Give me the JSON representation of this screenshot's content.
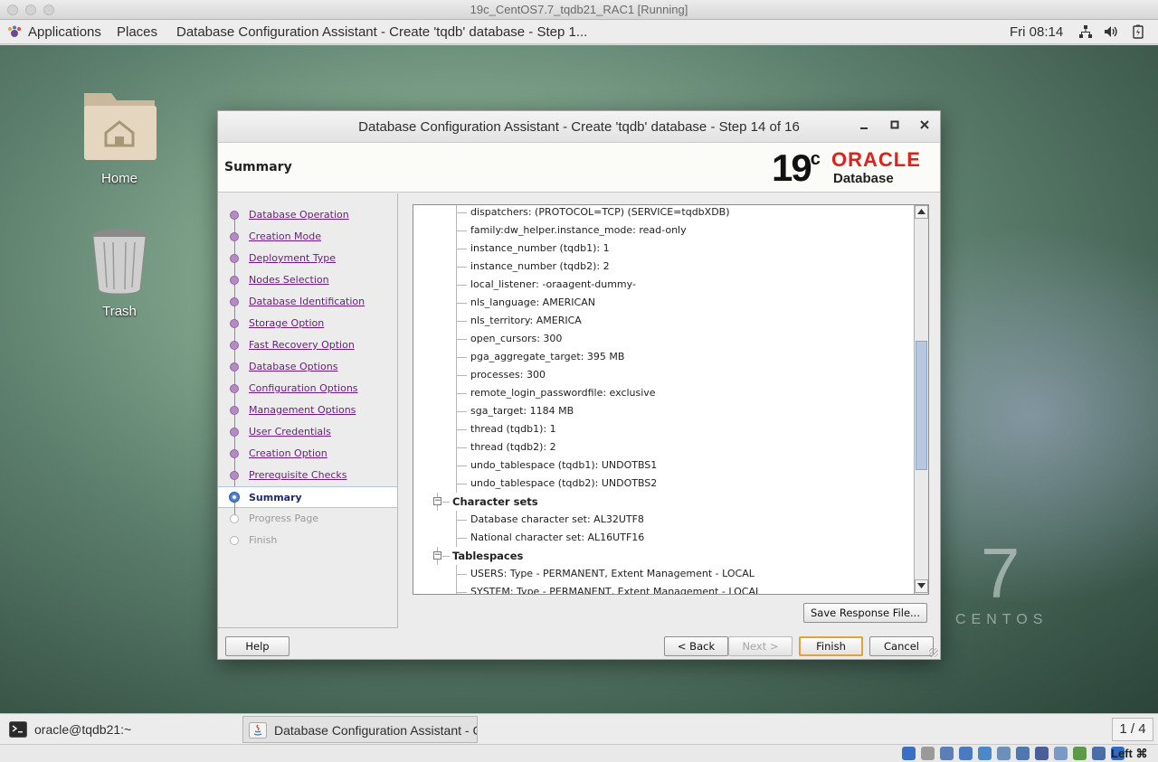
{
  "host_window": {
    "title": "19c_CentOS7.7_tqdb21_RAC1 [Running]"
  },
  "gnome_top": {
    "applications": "Applications",
    "places": "Places",
    "active_window": "Database Configuration Assistant - Create 'tqdb' database - Step 1...",
    "clock": "Fri 08:14",
    "tray_icons": [
      "network-icon",
      "volume-icon",
      "battery-icon"
    ]
  },
  "desktop": {
    "icons": [
      {
        "label": "Home"
      },
      {
        "label": "Trash"
      }
    ],
    "wallpaper_text": {
      "number": "7",
      "word": "CENTOS"
    }
  },
  "dialog": {
    "title": "Database Configuration Assistant - Create 'tqdb' database - Step 14 of 16",
    "header": "Summary",
    "logo": {
      "version": "19",
      "version_sup": "c",
      "brand": "ORACLE",
      "product": "Database"
    },
    "steps": [
      {
        "label": "Database Operation",
        "state": "done"
      },
      {
        "label": "Creation Mode",
        "state": "done"
      },
      {
        "label": "Deployment Type",
        "state": "done"
      },
      {
        "label": "Nodes Selection",
        "state": "done"
      },
      {
        "label": "Database Identification",
        "state": "done"
      },
      {
        "label": "Storage Option",
        "state": "done"
      },
      {
        "label": "Fast Recovery Option",
        "state": "done"
      },
      {
        "label": "Database Options",
        "state": "done"
      },
      {
        "label": "Configuration Options",
        "state": "done"
      },
      {
        "label": "Management Options",
        "state": "done"
      },
      {
        "label": "User Credentials",
        "state": "done"
      },
      {
        "label": "Creation Option",
        "state": "done"
      },
      {
        "label": "Prerequisite Checks",
        "state": "done"
      },
      {
        "label": "Summary",
        "state": "current"
      },
      {
        "label": "Progress Page",
        "state": "pending"
      },
      {
        "label": "Finish",
        "state": "pending"
      }
    ],
    "summary_rows": [
      {
        "text": "dispatchers: (PROTOCOL=TCP) (SERVICE=tqdbXDB)",
        "kind": "leaf"
      },
      {
        "text": "family:dw_helper.instance_mode: read-only",
        "kind": "leaf"
      },
      {
        "text": "instance_number (tqdb1): 1",
        "kind": "leaf"
      },
      {
        "text": "instance_number (tqdb2): 2",
        "kind": "leaf"
      },
      {
        "text": "local_listener: -oraagent-dummy-",
        "kind": "leaf"
      },
      {
        "text": "nls_language: AMERICAN",
        "kind": "leaf"
      },
      {
        "text": "nls_territory: AMERICA",
        "kind": "leaf"
      },
      {
        "text": "open_cursors: 300",
        "kind": "leaf"
      },
      {
        "text": "pga_aggregate_target: 395 MB",
        "kind": "leaf"
      },
      {
        "text": "processes: 300",
        "kind": "leaf"
      },
      {
        "text": "remote_login_passwordfile: exclusive",
        "kind": "leaf"
      },
      {
        "text": "sga_target: 1184 MB",
        "kind": "leaf"
      },
      {
        "text": "thread (tqdb1): 1",
        "kind": "leaf"
      },
      {
        "text": "thread (tqdb2): 2",
        "kind": "leaf"
      },
      {
        "text": "undo_tablespace (tqdb1): UNDOTBS1",
        "kind": "leaf"
      },
      {
        "text": "undo_tablespace (tqdb2): UNDOTBS2",
        "kind": "leaf"
      },
      {
        "text": "Character sets",
        "kind": "section"
      },
      {
        "text": "Database character set: AL32UTF8",
        "kind": "leaf"
      },
      {
        "text": "National character set: AL16UTF16",
        "kind": "leaf"
      },
      {
        "text": "Tablespaces",
        "kind": "section"
      },
      {
        "text": "USERS: Type - PERMANENT, Extent Management - LOCAL",
        "kind": "leaf"
      },
      {
        "text": "SYSTEM: Type - PERMANENT, Extent Management - LOCAL",
        "kind": "leaf"
      }
    ],
    "buttons": {
      "save_response": "Save Response File...",
      "help": "Help",
      "back": "< Back",
      "next": "Next >",
      "finish": "Finish",
      "cancel": "Cancel"
    }
  },
  "taskbar": {
    "tasks": [
      {
        "label": "oracle@tqdb21:~",
        "icon": "terminal-icon"
      },
      {
        "label": "Database Configuration Assistant - C...",
        "icon": "java-icon"
      }
    ],
    "workspace": "1 / 4"
  },
  "vb_status": {
    "icons": [
      "hard-disk-icon",
      "optical-drive-icon",
      "audio-icon",
      "network-adapter-icon",
      "usb-icon",
      "shared-folders-icon",
      "display-icon",
      "video-capture-icon",
      "virtualization-icon",
      "guest-additions-icon",
      "mouse-integration-icon",
      "download-icon"
    ],
    "host_key": "Left ⌘"
  },
  "colors": {
    "oracle_red": "#e0201b",
    "step_done": "#6a1a7e",
    "step_current": "#1c2c66"
  }
}
